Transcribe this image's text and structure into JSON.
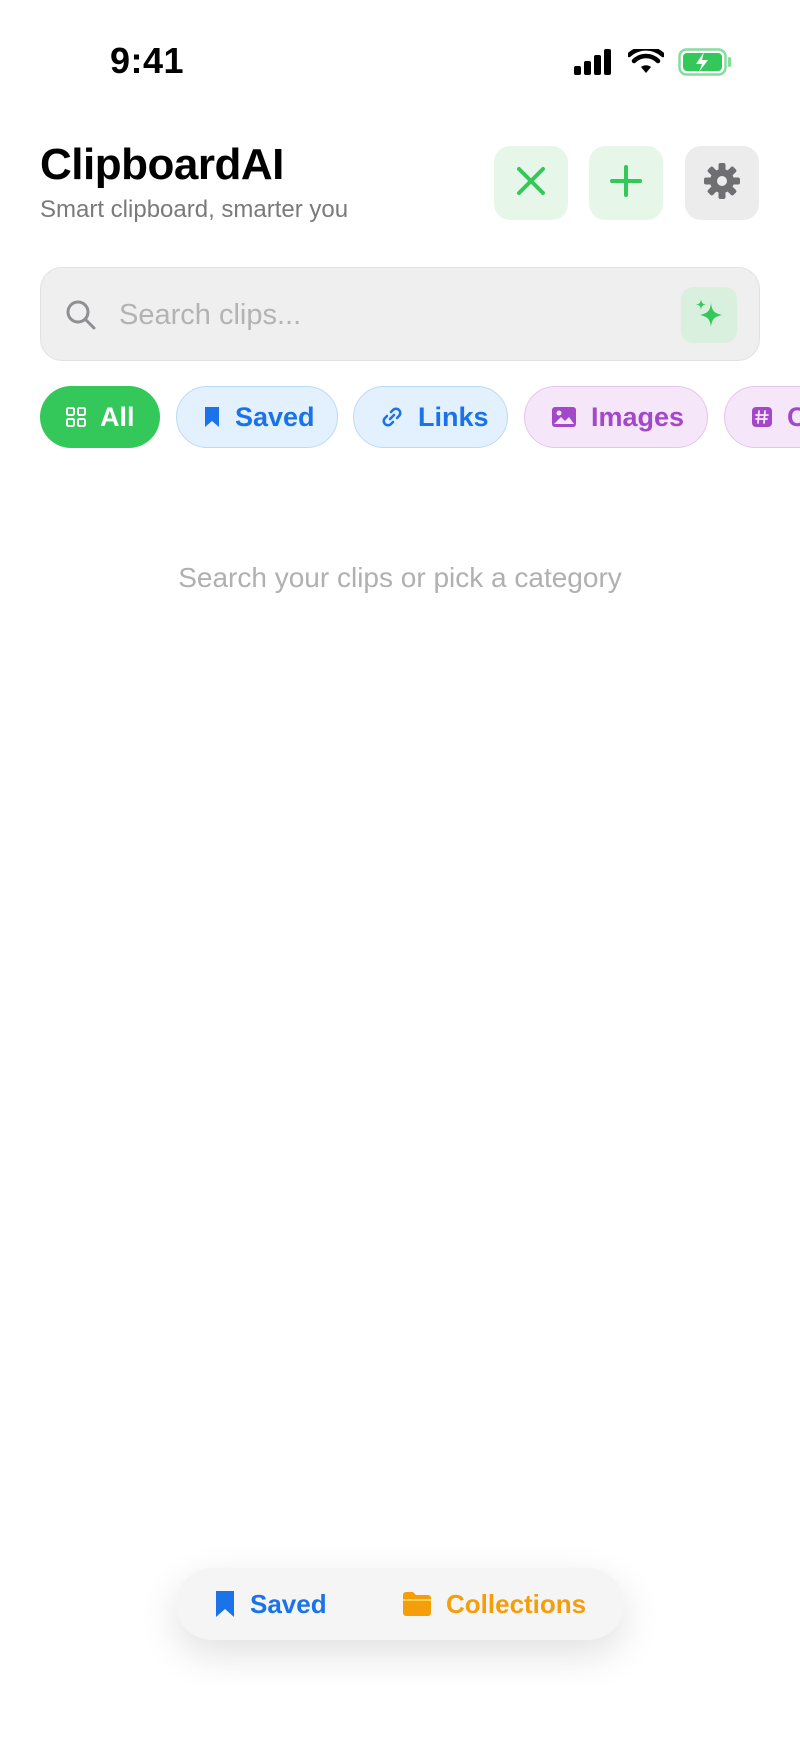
{
  "status_bar": {
    "time": "9:41"
  },
  "header": {
    "title": "ClipboardAI",
    "subtitle": "Smart clipboard, smarter you",
    "buttons": [
      {
        "icon": "close-icon",
        "color": "#34c759"
      },
      {
        "icon": "plus-icon",
        "color": "#34c759"
      },
      {
        "icon": "gear-icon",
        "color": "#6e6e73"
      }
    ]
  },
  "search": {
    "placeholder": "Search clips...",
    "value": ""
  },
  "categories": [
    {
      "label": "All",
      "icon": "grid-icon",
      "selected": true
    },
    {
      "label": "Saved",
      "icon": "bookmark-icon",
      "selected": false
    },
    {
      "label": "Links",
      "icon": "link-icon",
      "selected": false
    },
    {
      "label": "Images",
      "icon": "image-icon",
      "selected": false
    },
    {
      "label": "C",
      "icon": "hash-icon",
      "selected": false
    }
  ],
  "empty_state": {
    "message": "Search your clips or pick a category"
  },
  "bottom_bar": {
    "saved_label": "Saved",
    "collections_label": "Collections"
  },
  "colors": {
    "accent_green": "#34c759",
    "blue": "#1a73e8",
    "purple": "#a348c9",
    "orange": "#f59e0b"
  }
}
